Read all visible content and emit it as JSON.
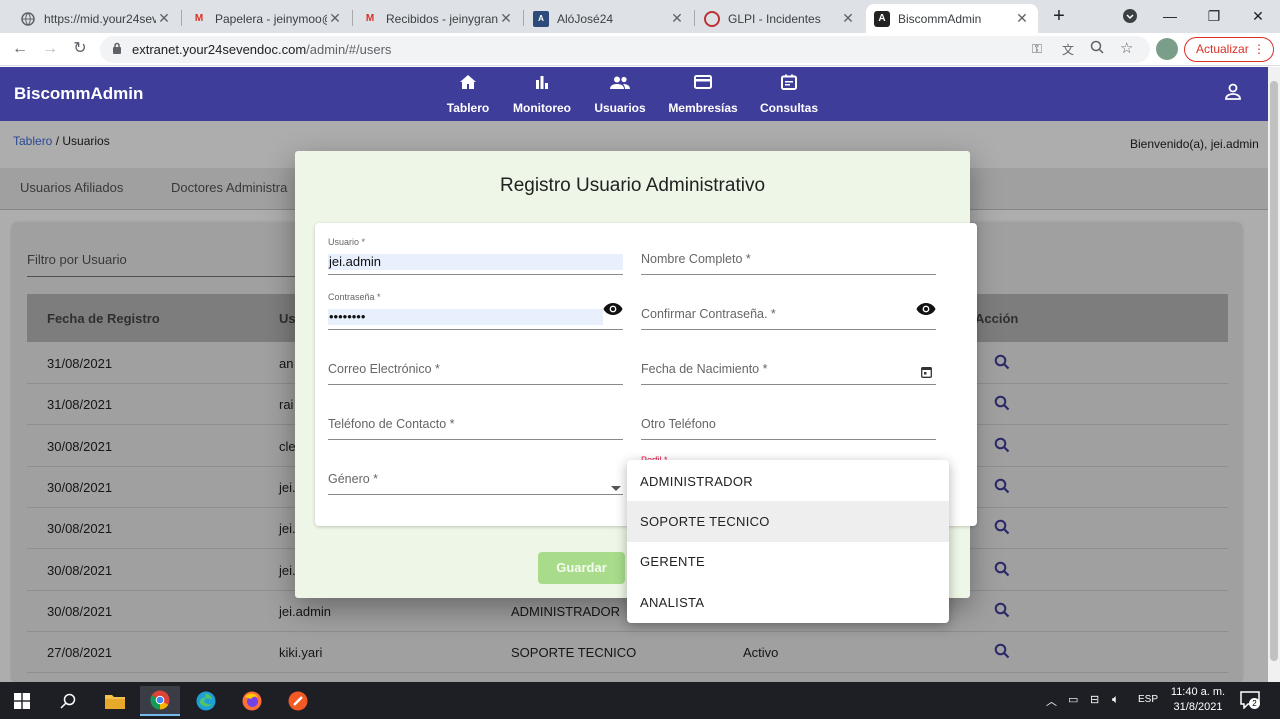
{
  "browser": {
    "tabs": [
      {
        "title": "https://mid.your24sev",
        "favicon": "globe-icon"
      },
      {
        "title": "Papelera - jeinymoo@",
        "favicon": "gmail-icon"
      },
      {
        "title": "Recibidos - jeinygran",
        "favicon": "gmail-icon"
      },
      {
        "title": "AlóJosé24",
        "favicon": "alojose-icon"
      },
      {
        "title": "GLPI - Incidentes",
        "favicon": "glpi-icon"
      },
      {
        "title": "BiscommAdmin",
        "favicon": "angular-icon"
      }
    ],
    "url_host": "extranet.your24sevendoc.com",
    "url_path": "/admin/#/users",
    "update_label": "Actualizar"
  },
  "app": {
    "brand": "BiscommAdmin",
    "nav": [
      {
        "label": "Tablero",
        "icon": "home-icon"
      },
      {
        "label": "Monitoreo",
        "icon": "bar-chart-icon"
      },
      {
        "label": "Usuarios",
        "icon": "people-icon"
      },
      {
        "label": "Membresías",
        "icon": "card-icon"
      },
      {
        "label": "Consultas",
        "icon": "calendar-icon"
      }
    ],
    "breadcrumb_link": "Tablero",
    "breadcrumb_current": " / Usuarios",
    "welcome": "Bienvenido(a), jei.admin"
  },
  "page": {
    "subtabs": [
      "Usuarios Afiliados",
      "Doctores Administra"
    ],
    "filter_label": "Filtro por Usuario",
    "columns": {
      "date": "Fecha de Registro",
      "user": "Us",
      "action": "Acción"
    },
    "rows": [
      {
        "date": "31/08/2021",
        "user": "an",
        "role": "",
        "status": ""
      },
      {
        "date": "31/08/2021",
        "user": "rai",
        "role": "",
        "status": ""
      },
      {
        "date": "30/08/2021",
        "user": "cle",
        "role": "",
        "status": ""
      },
      {
        "date": "30/08/2021",
        "user": "jei.",
        "role": "",
        "status": ""
      },
      {
        "date": "30/08/2021",
        "user": "jei.",
        "role": "",
        "status": ""
      },
      {
        "date": "30/08/2021",
        "user": "jei.",
        "role": "",
        "status": ""
      },
      {
        "date": "30/08/2021",
        "user": "jei.admin",
        "role": "ADMINISTRADOR",
        "status": ""
      },
      {
        "date": "27/08/2021",
        "user": "kiki.yari",
        "role": "SOPORTE TECNICO",
        "status": "Activo"
      }
    ]
  },
  "dialog": {
    "title": "Registro Usuario Administrativo",
    "fields": {
      "usuario_label": "Usuario *",
      "usuario_value": "jei.admin",
      "nombre_label": "Nombre Completo *",
      "contrasena_label": "Contraseña *",
      "contrasena_value": "••••••••",
      "confirmar_label": "Confirmar Contraseña. *",
      "correo_label": "Correo Electrónico *",
      "fecha_label": "Fecha de Nacimiento *",
      "telefono_label": "Teléfono de Contacto *",
      "otro_label": "Otro Teléfono",
      "genero_label": "Género *",
      "perfil_label": "Perfil *"
    },
    "save_label": "Guardar",
    "perfil_options": [
      "ADMINISTRADOR",
      "SOPORTE TECNICO",
      "GERENTE",
      "ANALISTA"
    ],
    "highlighted_option": "SOPORTE TECNICO"
  },
  "taskbar": {
    "lang": "ESP",
    "time": "11:40 a. m.",
    "date": "31/8/2021",
    "notifications": "2"
  },
  "colors": {
    "appbar": "#3f3d9a",
    "dialog_bg": "#eef7e7",
    "save_button": "#a8dc8a",
    "link": "#3f6dd8"
  }
}
